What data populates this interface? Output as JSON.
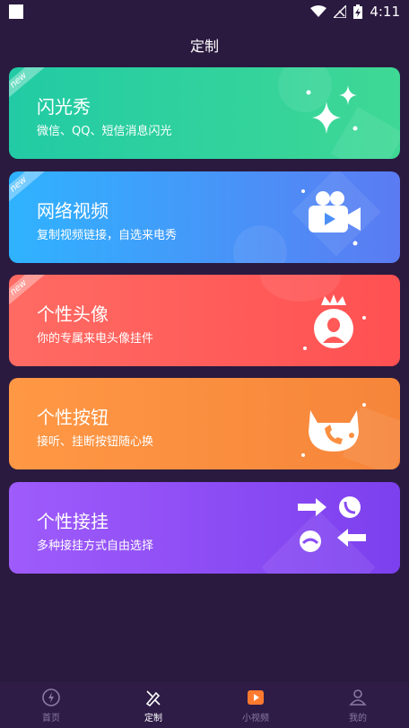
{
  "status_bar": {
    "time": "4:11"
  },
  "header": {
    "title": "定制"
  },
  "cards": [
    {
      "title": "闪光秀",
      "subtitle": "微信、QQ、短信消息闪光",
      "badge": "new",
      "icon": "sparkle-icon"
    },
    {
      "title": "网络视频",
      "subtitle": "复制视频链接，自选来电秀",
      "badge": "new",
      "icon": "video-camera-icon"
    },
    {
      "title": "个性头像",
      "subtitle": "你的专属来电头像挂件",
      "badge": "new",
      "icon": "crown-avatar-icon"
    },
    {
      "title": "个性按钮",
      "subtitle": "接听、挂断按钮随心换",
      "icon": "cat-phone-icon"
    },
    {
      "title": "个性接挂",
      "subtitle": "多种接挂方式自由选择",
      "icon": "answer-hangup-icon"
    }
  ],
  "tabs": [
    {
      "label": "首页",
      "icon": "lightning-icon",
      "active": false
    },
    {
      "label": "定制",
      "icon": "brush-icon",
      "active": true
    },
    {
      "label": "小视频",
      "icon": "play-icon",
      "active": false
    },
    {
      "label": "我的",
      "icon": "profile-icon",
      "active": false
    }
  ],
  "colors": {
    "background": "#2a1a3f",
    "card1": "#2ed29f",
    "card2": "#4a8ff8",
    "card3": "#ff5a58",
    "card4": "#fb8f40",
    "card5": "#8a4cf4",
    "tab_active": "#ffffff",
    "tab_inactive": "#8a7aa3"
  }
}
